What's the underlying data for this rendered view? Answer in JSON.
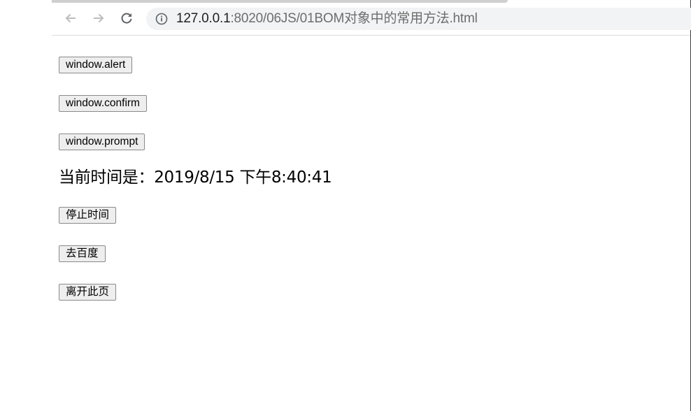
{
  "browser": {
    "url_host": "127.0.0.1",
    "url_path": ":8020/06JS/01BOM对象中的常用方法.html",
    "icons": {
      "back": "arrow-left-icon",
      "forward": "arrow-right-icon",
      "reload": "reload-icon",
      "site_info": "info-circle-icon"
    }
  },
  "page": {
    "buttons": {
      "alert": "window.alert",
      "confirm": "window.confirm",
      "prompt": "window.prompt",
      "stop_time": "停止时间",
      "go_baidu": "去百度",
      "leave_page": "离开此页"
    },
    "time_label": "当前时间是：2019/8/15 下午8:40:41"
  }
}
